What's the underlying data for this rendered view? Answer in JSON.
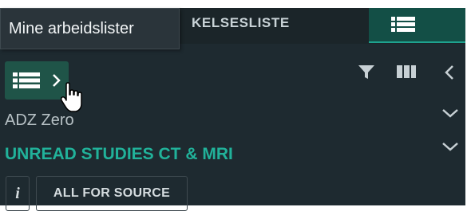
{
  "tooltip": {
    "text": "Mine arbeidslister"
  },
  "header": {
    "tab_label": "KELSESLISTE",
    "active_tab_icon": "list-icon"
  },
  "toolbar": {
    "worklist_toggle_icon": "list-icon",
    "worklist_toggle_chevron": "chevron-right-icon",
    "filter_icon": "filter-icon",
    "columns_icon": "columns-icon",
    "collapse_icon": "chevron-left-icon"
  },
  "rows": [
    {
      "label": "ADZ Zero",
      "icon": "chevron-down-icon"
    },
    {
      "label": "UNREAD STUDIES CT & MRI",
      "icon": "chevron-down-icon",
      "color": "#21b29a"
    }
  ],
  "actions": {
    "info_label": "i",
    "source_label": "ALL FOR SOURCE"
  },
  "colors": {
    "background": "#1e2a30",
    "accent": "#21b29a",
    "active_tab": "#134f46",
    "toggle_bg": "#1f5448"
  }
}
